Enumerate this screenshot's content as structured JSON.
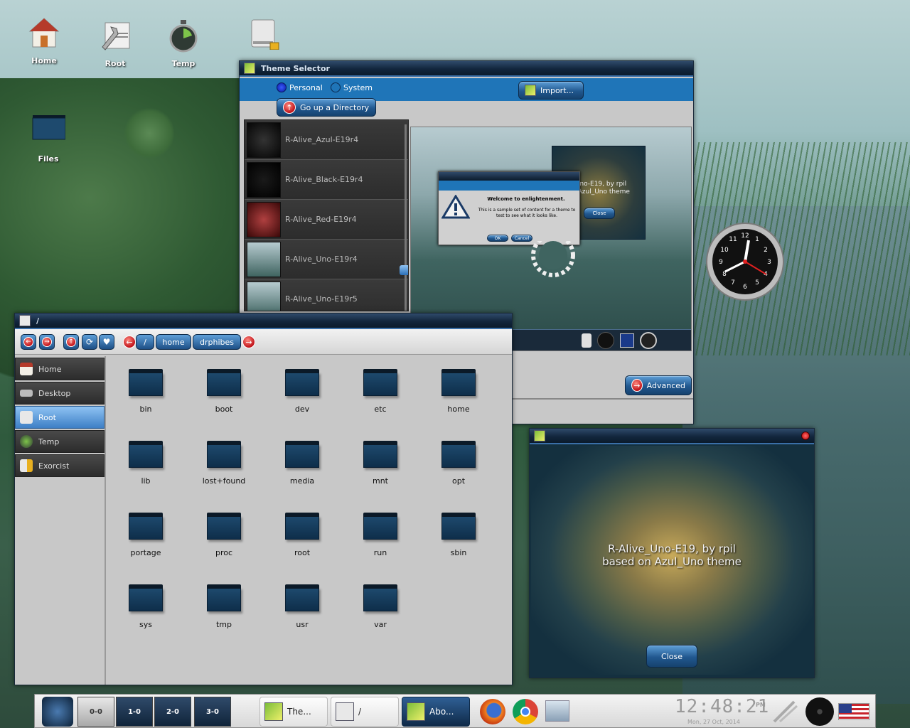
{
  "desktop": {
    "icons": [
      {
        "label": "Home",
        "icon": "home-icon"
      },
      {
        "label": "Root",
        "icon": "root-folder-icon"
      },
      {
        "label": "Temp",
        "icon": "stopwatch-icon"
      },
      {
        "label": "Files",
        "icon": "folder-icon"
      }
    ]
  },
  "theme_selector": {
    "title": "Theme Selector",
    "radio_personal": "Personal",
    "radio_system": "System",
    "go_up": "Go up a Directory",
    "import": "Import...",
    "advanced": "Advanced",
    "themes": [
      "R-Alive_Azul-E19r4",
      "R-Alive_Black-E19r4",
      "R-Alive_Red-E19r4",
      "R-Alive_Uno-E19r4",
      "R-Alive_Uno-E19r5"
    ],
    "preview": {
      "dialog_title": "Welcome to enlightenment.",
      "dialog_body": "This is a sample set of content for a theme to test to see what it looks like.",
      "ok": "OK",
      "cancel": "Cancel",
      "about_text_1": "Uno-E19, by rpil",
      "about_text_2": "n Azul_Uno theme",
      "close": "Close"
    }
  },
  "file_manager": {
    "title": "/",
    "breadcrumbs": [
      "/",
      "home",
      "drphibes"
    ],
    "sidebar": [
      "Home",
      "Desktop",
      "Root",
      "Temp",
      "Exorcist"
    ],
    "active_sidebar": "Root",
    "folders": [
      "bin",
      "boot",
      "dev",
      "etc",
      "home",
      "lib",
      "lost+found",
      "media",
      "mnt",
      "opt",
      "portage",
      "proc",
      "root",
      "run",
      "sbin",
      "sys",
      "tmp",
      "usr",
      "var"
    ]
  },
  "about_window": {
    "line1": "R-Alive_Uno-E19, by rpil",
    "line2": "based on Azul_Uno theme",
    "close": "Close"
  },
  "taskbar": {
    "desktops": [
      "0-0",
      "1-0",
      "2-0",
      "3-0"
    ],
    "tasks": [
      {
        "label": "The...",
        "active": false
      },
      {
        "label": "/",
        "active": false
      },
      {
        "label": "Abo...",
        "active": true
      }
    ],
    "clock_time": "12:48:21",
    "clock_ampm": "PM",
    "clock_date": "Mon, 27 Oct, 2014"
  },
  "clock_gadget": {
    "numbers": [
      "12",
      "1",
      "2",
      "3",
      "4",
      "5",
      "6",
      "7",
      "8",
      "9",
      "10",
      "11"
    ]
  }
}
